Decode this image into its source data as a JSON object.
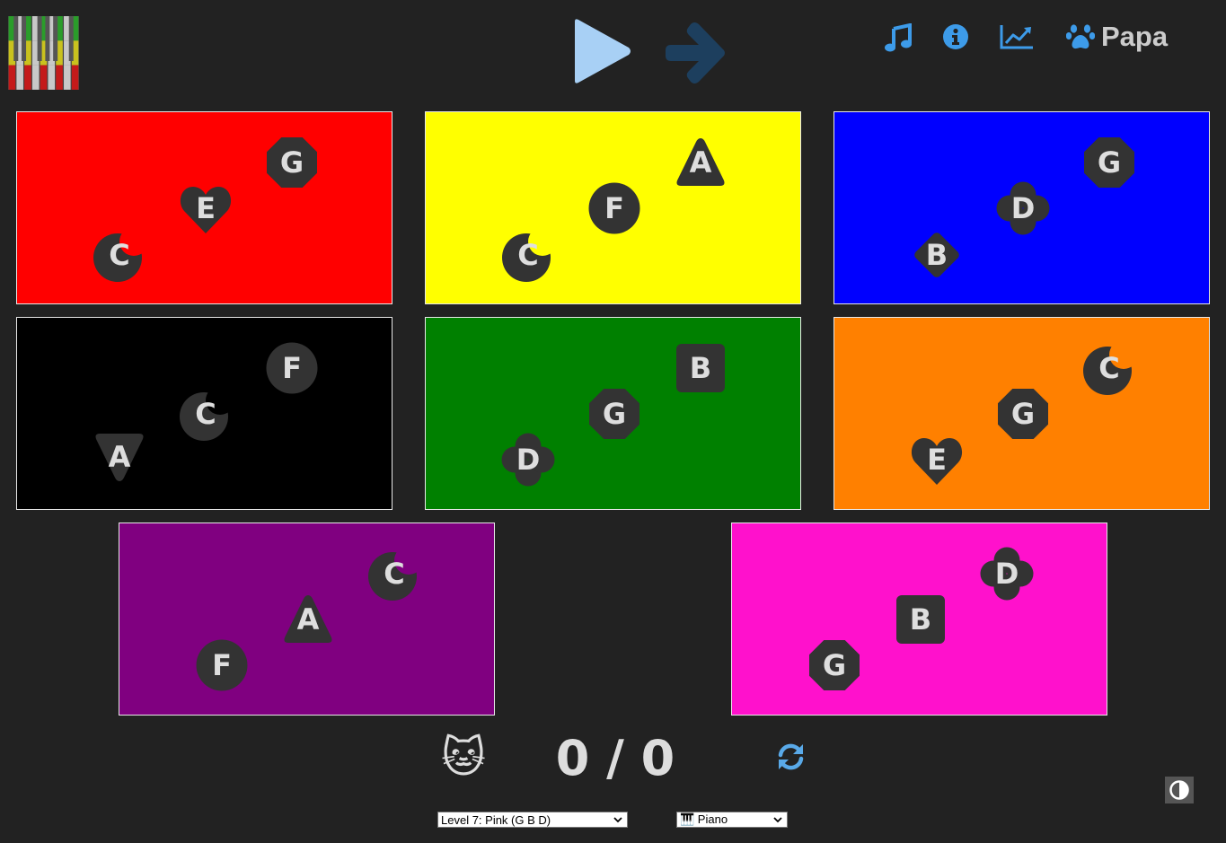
{
  "header": {
    "profile_name": "Papa",
    "icons": [
      "keyboard-logo-icon",
      "play-icon",
      "next-arrow-icon",
      "music-note-icon",
      "info-icon",
      "chart-line-icon",
      "paw-icon"
    ]
  },
  "colors": {
    "background": "#222222",
    "note_shape": "#333333",
    "note_text": "#dedede",
    "accent_blue": "#3d9be9",
    "play_blue": "#a8d0f5",
    "arrow_dark_blue": "#1d3f5e",
    "refresh_blue": "#59a9e8"
  },
  "tiles": [
    {
      "color": "#ff0000",
      "notes": [
        {
          "label": "C",
          "shape": "moon"
        },
        {
          "label": "E",
          "shape": "heart"
        },
        {
          "label": "G",
          "shape": "octagon"
        }
      ]
    },
    {
      "color": "#ffff00",
      "notes": [
        {
          "label": "C",
          "shape": "moon"
        },
        {
          "label": "F",
          "shape": "circle"
        },
        {
          "label": "A",
          "shape": "triangle"
        }
      ]
    },
    {
      "color": "#0000ff",
      "notes": [
        {
          "label": "B",
          "shape": "diamond"
        },
        {
          "label": "D",
          "shape": "clover"
        },
        {
          "label": "G",
          "shape": "octagon"
        }
      ]
    },
    {
      "color": "#000000",
      "notes": [
        {
          "label": "A",
          "shape": "triangle-down"
        },
        {
          "label": "C",
          "shape": "moon"
        },
        {
          "label": "F",
          "shape": "circle"
        }
      ]
    },
    {
      "color": "#008000",
      "notes": [
        {
          "label": "D",
          "shape": "clover"
        },
        {
          "label": "G",
          "shape": "octagon"
        },
        {
          "label": "B",
          "shape": "square"
        }
      ]
    },
    {
      "color": "#ff8000",
      "notes": [
        {
          "label": "E",
          "shape": "heart"
        },
        {
          "label": "G",
          "shape": "octagon"
        },
        {
          "label": "C",
          "shape": "moon"
        }
      ]
    },
    {
      "color": "#800080",
      "notes": [
        {
          "label": "F",
          "shape": "circle"
        },
        {
          "label": "A",
          "shape": "triangle"
        },
        {
          "label": "C",
          "shape": "moon"
        }
      ]
    },
    {
      "color": "#ff11cc",
      "notes": [
        {
          "label": "G",
          "shape": "octagon"
        },
        {
          "label": "B",
          "shape": "square"
        },
        {
          "label": "D",
          "shape": "clover"
        }
      ]
    }
  ],
  "footer": {
    "cat_emoji": "🐱",
    "score": "0 / 0",
    "level_select": "Level 7: Pink (G B D)",
    "instrument_select": "🎹 Piano",
    "icons": [
      "refresh-icon",
      "contrast-icon"
    ]
  }
}
